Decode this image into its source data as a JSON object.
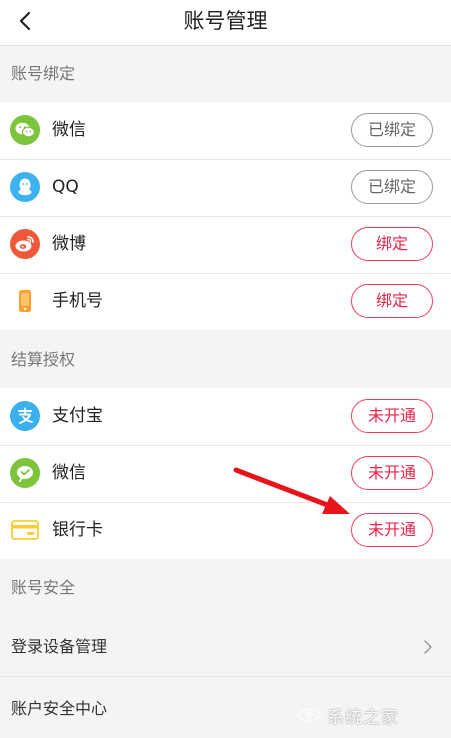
{
  "header": {
    "title": "账号管理",
    "back_icon": "chevron-left-icon"
  },
  "sections": {
    "binding": {
      "title": "账号绑定",
      "items": [
        {
          "label": "微信",
          "icon": "wechat-icon",
          "action": "已绑定",
          "state": "bound",
          "color": "#7bc43c"
        },
        {
          "label": "QQ",
          "icon": "qq-icon",
          "action": "已绑定",
          "state": "bound",
          "color": "#3db2f0"
        },
        {
          "label": "微博",
          "icon": "weibo-icon",
          "action": "绑定",
          "state": "unbound",
          "color": "#f0583a"
        },
        {
          "label": "手机号",
          "icon": "phone-icon",
          "action": "绑定",
          "state": "unbound",
          "color": "#ff9f2e"
        }
      ]
    },
    "settlement": {
      "title": "结算授权",
      "items": [
        {
          "label": "支付宝",
          "icon": "alipay-icon",
          "action": "未开通",
          "state": "unbound",
          "color": "#3ab0ee"
        },
        {
          "label": "微信",
          "icon": "wechat-pay-icon",
          "action": "未开通",
          "state": "unbound",
          "color": "#7bc43c"
        },
        {
          "label": "银行卡",
          "icon": "bank-card-icon",
          "action": "未开通",
          "state": "unbound",
          "color": "#ffcc33"
        }
      ]
    },
    "security": {
      "title": "账号安全",
      "items": [
        {
          "label": "登录设备管理"
        },
        {
          "label": "账户安全中心"
        }
      ]
    }
  },
  "colors": {
    "accent": "#e8244a",
    "bound_border": "#9a9a9a",
    "annotation_arrow": "#e8141c"
  },
  "watermark": {
    "text": "系统之家"
  }
}
